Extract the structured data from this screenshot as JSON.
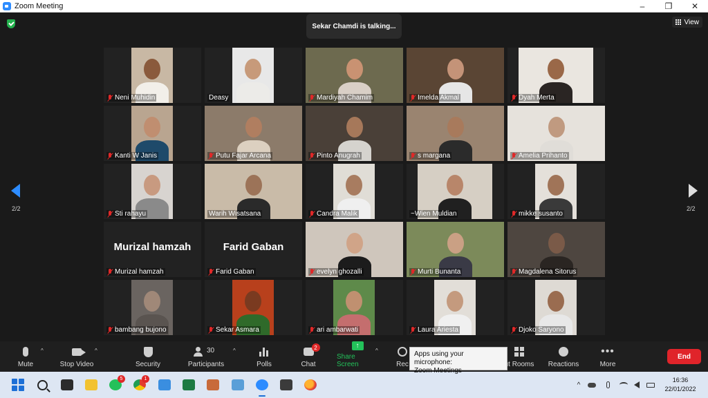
{
  "window": {
    "title": "Zoom Meeting",
    "minimize": "–",
    "maximize": "❐",
    "close": "✕"
  },
  "banner": {
    "talking": "Sekar Chamdi is talking..."
  },
  "view": {
    "label": "View"
  },
  "pager": {
    "left": "2/2",
    "right": "2/2"
  },
  "participants": [
    {
      "name": "Neni Muhidin",
      "muted": true,
      "bg": "#c8b8a4",
      "skin": "#8a5a3c",
      "shirt": "#f2efe9",
      "mode": "center"
    },
    {
      "name": "Deasy",
      "muted": false,
      "bg": "#e8e8e8",
      "skin": "#c79a7a",
      "shirt": "#ecebe8",
      "mode": "center"
    },
    {
      "name": "Mardiyah Chamim",
      "muted": true,
      "bg": "#6d6a4f",
      "skin": "#c99272",
      "shirt": "#d9cfc6",
      "mode": "full"
    },
    {
      "name": "Imelda Akmal",
      "muted": true,
      "bg": "#5a4534",
      "skin": "#c49378",
      "shirt": "#e6e6e6",
      "mode": "full"
    },
    {
      "name": "Dyah Merta",
      "muted": true,
      "bg": "#eae6e0",
      "skin": "#9a6848",
      "shirt": "#2a2523",
      "mode": "center-wide"
    },
    {
      "name": "Kanti W Janis",
      "muted": true,
      "bg": "#b9a590",
      "skin": "#c08e70",
      "shirt": "#1e4a6a",
      "mode": "center"
    },
    {
      "name": "Putu Fajar Arcana",
      "muted": true,
      "bg": "#8c7b6a",
      "skin": "#b07e60",
      "shirt": "#dcd0c0",
      "mode": "full"
    },
    {
      "name": "Pinto Anugrah",
      "muted": true,
      "bg": "#4a4038",
      "skin": "#a6785a",
      "shirt": "#d5d3ce",
      "mode": "full"
    },
    {
      "name": "s margana",
      "muted": true,
      "bg": "#9a8470",
      "skin": "#a87a5c",
      "shirt": "#2b2b2b",
      "mode": "full"
    },
    {
      "name": "Amelia Prihanto",
      "muted": true,
      "bg": "#e6e2dc",
      "skin": "#c09a80",
      "shirt": "#e0ddd8",
      "mode": "full"
    },
    {
      "name": "Sti rahayu",
      "muted": true,
      "bg": "#d8d4d0",
      "skin": "#c89a80",
      "shirt": "#8a8a8a",
      "mode": "center"
    },
    {
      "name": "Warih Wisatsana",
      "muted": false,
      "bg": "#c9bba8",
      "skin": "#9c7358",
      "shirt": "#2a2a2a",
      "mode": "full"
    },
    {
      "name": "Candra Malik",
      "muted": true,
      "bg": "#e0ddd6",
      "skin": "#a87c60",
      "shirt": "#efefef",
      "mode": "center"
    },
    {
      "name": "~Wien Muldian",
      "muted": false,
      "bg": "#d6cfc4",
      "skin": "#b8866a",
      "shirt": "#202020",
      "mode": "center-wide"
    },
    {
      "name": "mikke susanto",
      "muted": true,
      "bg": "#e4e0da",
      "skin": "#a07458",
      "shirt": "#3a3a3a",
      "mode": "center"
    },
    {
      "name": "Murizal hamzah",
      "muted": true,
      "bigname": "Murizal hamzah",
      "mode": "name"
    },
    {
      "name": "Farid Gaban",
      "muted": true,
      "bigname": "Farid Gaban",
      "mode": "name"
    },
    {
      "name": "evelyn ghozalli",
      "muted": true,
      "bg": "#cfc6bc",
      "skin": "#d0a488",
      "shirt": "#1c1c1c",
      "mode": "full"
    },
    {
      "name": "Murti Bunanta",
      "muted": true,
      "bg": "#7c8a5a",
      "skin": "#caa084",
      "shirt": "#3a3a46",
      "mode": "full"
    },
    {
      "name": "Magdalena Sitorus",
      "muted": true,
      "bg": "#4e4640",
      "skin": "#7a5a48",
      "shirt": "#2a2522",
      "mode": "full"
    },
    {
      "name": "bambang bujono",
      "muted": true,
      "bg": "#6a6460",
      "skin": "#a08878",
      "shirt": "#5a5450",
      "mode": "center"
    },
    {
      "name": "Sekar Asmara",
      "muted": true,
      "bg": "#b8401c",
      "skin": "#7a3a20",
      "shirt": "#2f6a2a",
      "mode": "center"
    },
    {
      "name": "ari ambarwati",
      "muted": true,
      "bg": "#5e8a4a",
      "skin": "#c09070",
      "shirt": "#c46e6e",
      "mode": "center"
    },
    {
      "name": "Laura Ariesta",
      "muted": true,
      "bg": "#e2ded8",
      "skin": "#c49a7e",
      "shirt": "#f0f0f0",
      "mode": "center"
    },
    {
      "name": "Djoko Saryono",
      "muted": true,
      "bg": "#dedad4",
      "skin": "#9a6c50",
      "shirt": "#e8e8e8",
      "mode": "center"
    }
  ],
  "toolbar": {
    "mute": "Mute",
    "stop_video": "Stop Video",
    "security": "Security",
    "participants": "Participants",
    "participants_count": "30",
    "polls": "Polls",
    "chat": "Chat",
    "chat_badge": "2",
    "share_screen": "Share Screen",
    "record": "Rec",
    "breakout": "ut Rooms",
    "reactions": "Reactions",
    "more": "More",
    "end": "End",
    "caret": "^",
    "more_dots": "•••",
    "share_arrow": "↑"
  },
  "tooltip": {
    "line1": "Apps using your microphone:",
    "line2": "Zoom Meetings"
  },
  "taskbar": {
    "whatsapp_badge": "5",
    "chrome_badge": "1",
    "tray_caret": "^",
    "time": "16:36",
    "date": "22/01/2022"
  },
  "colors": {
    "zoom_blue": "#2d8cff",
    "end_red": "#e0242a",
    "share_green": "#23c15a",
    "muted_red": "#e02828"
  }
}
